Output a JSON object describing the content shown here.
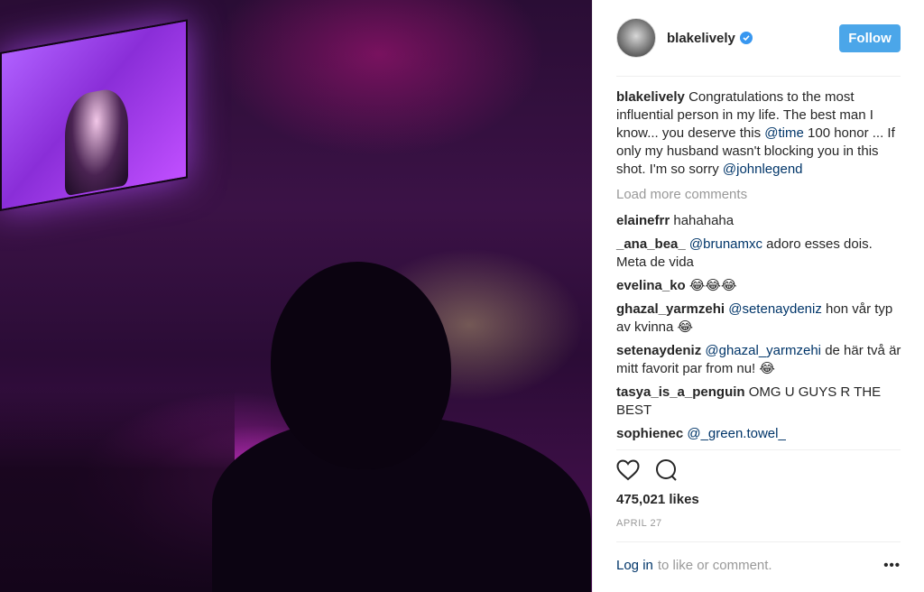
{
  "post": {
    "photo_alt": "Concert photo",
    "username": "blakelively",
    "verified": true,
    "follow_label": "Follow",
    "caption": {
      "user": "blakelively",
      "text_1": "Congratulations to the most influential person in my life. The best man I know... you deserve this ",
      "mention_1": "@time",
      "text_2": " 100 honor ... If only my husband wasn't blocking you in this shot. I'm so sorry ",
      "mention_2": "@johnlegend"
    },
    "load_more_label": "Load more comments",
    "comments": [
      {
        "user": "elainefrr",
        "mention": "",
        "text": "hahahaha"
      },
      {
        "user": "_ana_bea_",
        "mention": "@brunamxc",
        "text": "adoro esses dois. Meta de vida"
      },
      {
        "user": "evelina_ko",
        "mention": "",
        "text": "😂😂😂"
      },
      {
        "user": "ghazal_yarmzehi",
        "mention": "@setenaydeniz",
        "text": "hon vår typ av kvinna 😂"
      },
      {
        "user": "setenaydeniz",
        "mention": "@ghazal_yarmzehi",
        "text": "de här två är mitt favorit par from nu! 😂"
      },
      {
        "user": "tasya_is_a_penguin",
        "mention": "",
        "text": "OMG U GUYS R THE BEST"
      },
      {
        "user": "sophienec",
        "mention": "@_green.towel_",
        "text": ""
      }
    ],
    "likes": "475,021 likes",
    "date": "APRIL 27",
    "login_link": "Log in",
    "login_text": "to like or comment.",
    "more_dots": "•••",
    "icons": {
      "like": "heart-icon",
      "comment": "comment-bubble-icon",
      "verified": "verified-badge-icon",
      "more": "more-options-icon"
    },
    "colors": {
      "follow_button": "#4ba6e9",
      "mention": "#003569",
      "verified": "#3897f0",
      "muted": "#999999"
    }
  }
}
